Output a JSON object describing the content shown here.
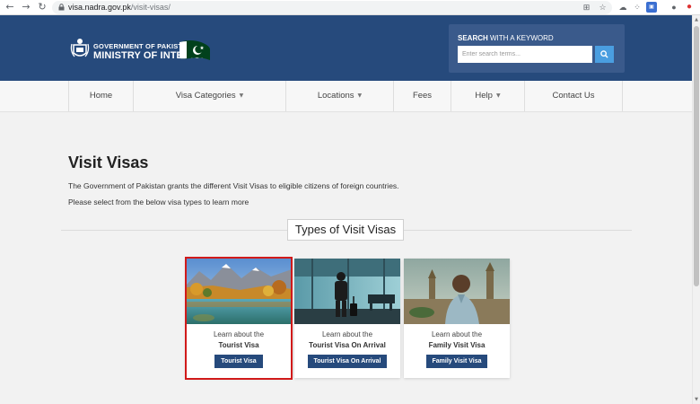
{
  "browser": {
    "url_host": "visa.nadra.gov.pk",
    "url_path": "/visit-visas/"
  },
  "header": {
    "logo_line1": "GOVERNMENT OF PAKISTAN",
    "logo_line2": "MINISTRY OF INTERIOR",
    "search_label_bold": "SEARCH",
    "search_label_rest": " WITH A KEYWORD",
    "search_placeholder": "Enter search terms..."
  },
  "nav": {
    "items": [
      {
        "label": "Home"
      },
      {
        "label": "Visa Categories"
      },
      {
        "label": "Locations"
      },
      {
        "label": "Fees"
      },
      {
        "label": "Help"
      },
      {
        "label": "Contact Us"
      }
    ]
  },
  "main": {
    "title": "Visit Visas",
    "intro_1": "The Government of Pakistan grants the different Visit Visas to eligible citizens of foreign countries.",
    "intro_2": "Please select from the below visa types to learn more",
    "section_title": "Types of Visit Visas",
    "cards": [
      {
        "line1": "Learn about the",
        "line2": "Tourist Visa",
        "button": "Tourist Visa"
      },
      {
        "line1": "Learn about the",
        "line2": "Tourist Visa On Arrival",
        "button": "Tourist Visa On Arrival"
      },
      {
        "line1": "Learn about the",
        "line2": "Family Visit Visa",
        "button": "Family Visit Visa"
      }
    ]
  },
  "colors": {
    "header_bg": "#264a7c",
    "button_bg": "#264a7c",
    "search_button": "#4a9ee0",
    "highlight": "#d11a1a"
  }
}
